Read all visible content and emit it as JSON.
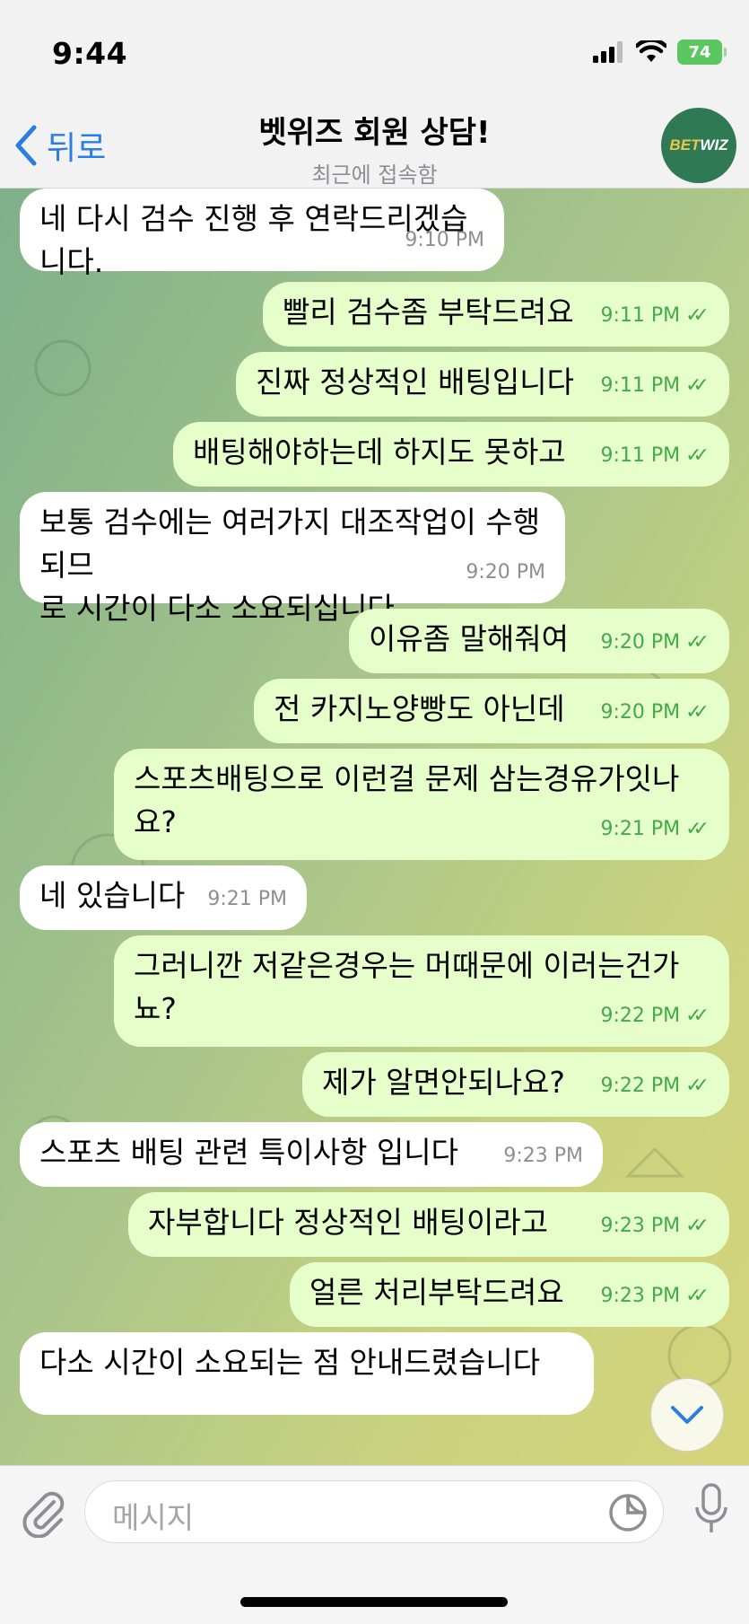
{
  "status": {
    "time": "9:44",
    "battery": "74"
  },
  "header": {
    "back_label": "뒤로",
    "title": "벳위즈 회원 상담!",
    "subtitle": "최근에 접속함",
    "avatar_bet": "BET",
    "avatar_wiz": "WIZ"
  },
  "messages": [
    {
      "dir": "in",
      "lines": [
        "네 다시 검수 진행 후 연락드리겠습니다."
      ],
      "time": "9:10 PM"
    },
    {
      "dir": "out",
      "lines": [
        "빨리 검수좀 부탁드려요"
      ],
      "time": "9:11 PM"
    },
    {
      "dir": "out",
      "lines": [
        "진짜 정상적인 배팅입니다"
      ],
      "time": "9:11 PM"
    },
    {
      "dir": "out",
      "lines": [
        "배팅해야하는데 하지도 못하고"
      ],
      "time": "9:11 PM"
    },
    {
      "dir": "in",
      "lines": [
        "보통 검수에는 여러가지 대조작업이 수행되므",
        "로 시간이 다소 소요되십니다."
      ],
      "time": "9:20 PM"
    },
    {
      "dir": "out",
      "lines": [
        "이유좀 말해줘여"
      ],
      "time": "9:20 PM"
    },
    {
      "dir": "out",
      "lines": [
        "전 카지노양빵도 아닌데"
      ],
      "time": "9:20 PM"
    },
    {
      "dir": "out",
      "lines": [
        "스포츠배팅으로 이런걸 문제 삼는경유가잇나",
        "요?"
      ],
      "time": "9:21 PM"
    },
    {
      "dir": "in",
      "lines": [
        "네 있습니다"
      ],
      "time": "9:21 PM"
    },
    {
      "dir": "out",
      "lines": [
        "그러니깐 저같은경우는 머때문에 이러는건가",
        "뇨?"
      ],
      "time": "9:22 PM"
    },
    {
      "dir": "out",
      "lines": [
        "제가 알면안되나요?"
      ],
      "time": "9:22 PM"
    },
    {
      "dir": "in",
      "lines": [
        "스포츠 배팅 관련 특이사항 입니다"
      ],
      "time": "9:23 PM"
    },
    {
      "dir": "out",
      "lines": [
        "자부합니다 정상적인 배팅이라고"
      ],
      "time": "9:23 PM"
    },
    {
      "dir": "out",
      "lines": [
        "얼른 처리부탁드려요"
      ],
      "time": "9:23 PM"
    },
    {
      "dir": "in",
      "lines": [
        "다소 시간이 소요되는 점 안내드렸습니다"
      ],
      "time": ""
    }
  ],
  "composer": {
    "placeholder": "메시지"
  },
  "icons": {
    "attach": "paperclip-icon",
    "sticker": "sticker-icon",
    "mic": "microphone-icon",
    "scroll": "chevron-down-icon"
  }
}
